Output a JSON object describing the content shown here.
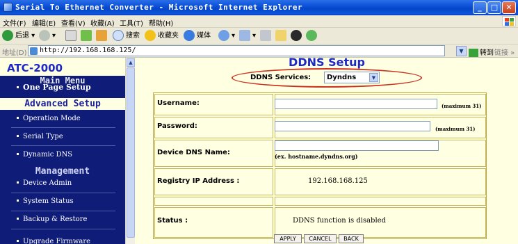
{
  "window": {
    "title": "Serial To Ethernet Converter - Microsoft Internet Explorer",
    "minimize": "_",
    "maximize": "□",
    "close": "✕"
  },
  "menubar": {
    "items": [
      "文件(F)",
      "编辑(E)",
      "查看(V)",
      "收藏(A)",
      "工具(T)",
      "帮助(H)"
    ]
  },
  "toolbar": {
    "back_label": "后退",
    "search_label": "搜索",
    "favorites_label": "收藏夹",
    "media_label": "媒体"
  },
  "address": {
    "label": "地址(D)",
    "url": "http://192.168.168.125/",
    "go_label": "转到",
    "links_label": "链接"
  },
  "sidebar": {
    "brand": "ATC-2000",
    "main_menu": "Main Menu",
    "one_page_setup": "One Page Setup",
    "advanced_setup": "Advanced Setup",
    "advanced_items": [
      "Operation Mode",
      "Serial Type",
      "Dynamic DNS"
    ],
    "management": "Management",
    "management_items": [
      "Device Admin",
      "System Status",
      "Backup & Restore",
      "Upgrade Firmware"
    ]
  },
  "main": {
    "title": "DDNS Setup",
    "ddns_services_label": "DDNS Services:",
    "ddns_service_selected": "Dyndns",
    "username_label": "Username:",
    "username_value": "",
    "username_hint": "(maximum 31)",
    "password_label": "Password:",
    "password_value": "",
    "password_hint": "(maximum 31)",
    "device_dns_label": "Device DNS Name:",
    "device_dns_value": "",
    "device_dns_hint": "(ex. hostname.dyndns.org)",
    "registry_ip_label": "Registry IP Address :",
    "registry_ip_value": "192.168.168.125",
    "status_label": "Status :",
    "status_value": "DDNS function is disabled",
    "apply_label": "APPLY",
    "cancel_label": "CANCEL",
    "back_label": "BACK"
  },
  "colors": {
    "page_bg": "#ffffe1",
    "sidebar_bg": "#0f1c78",
    "title_blue": "#1d28c9",
    "annotation_red": "#cc3322",
    "table_border": "#c8b85c"
  }
}
